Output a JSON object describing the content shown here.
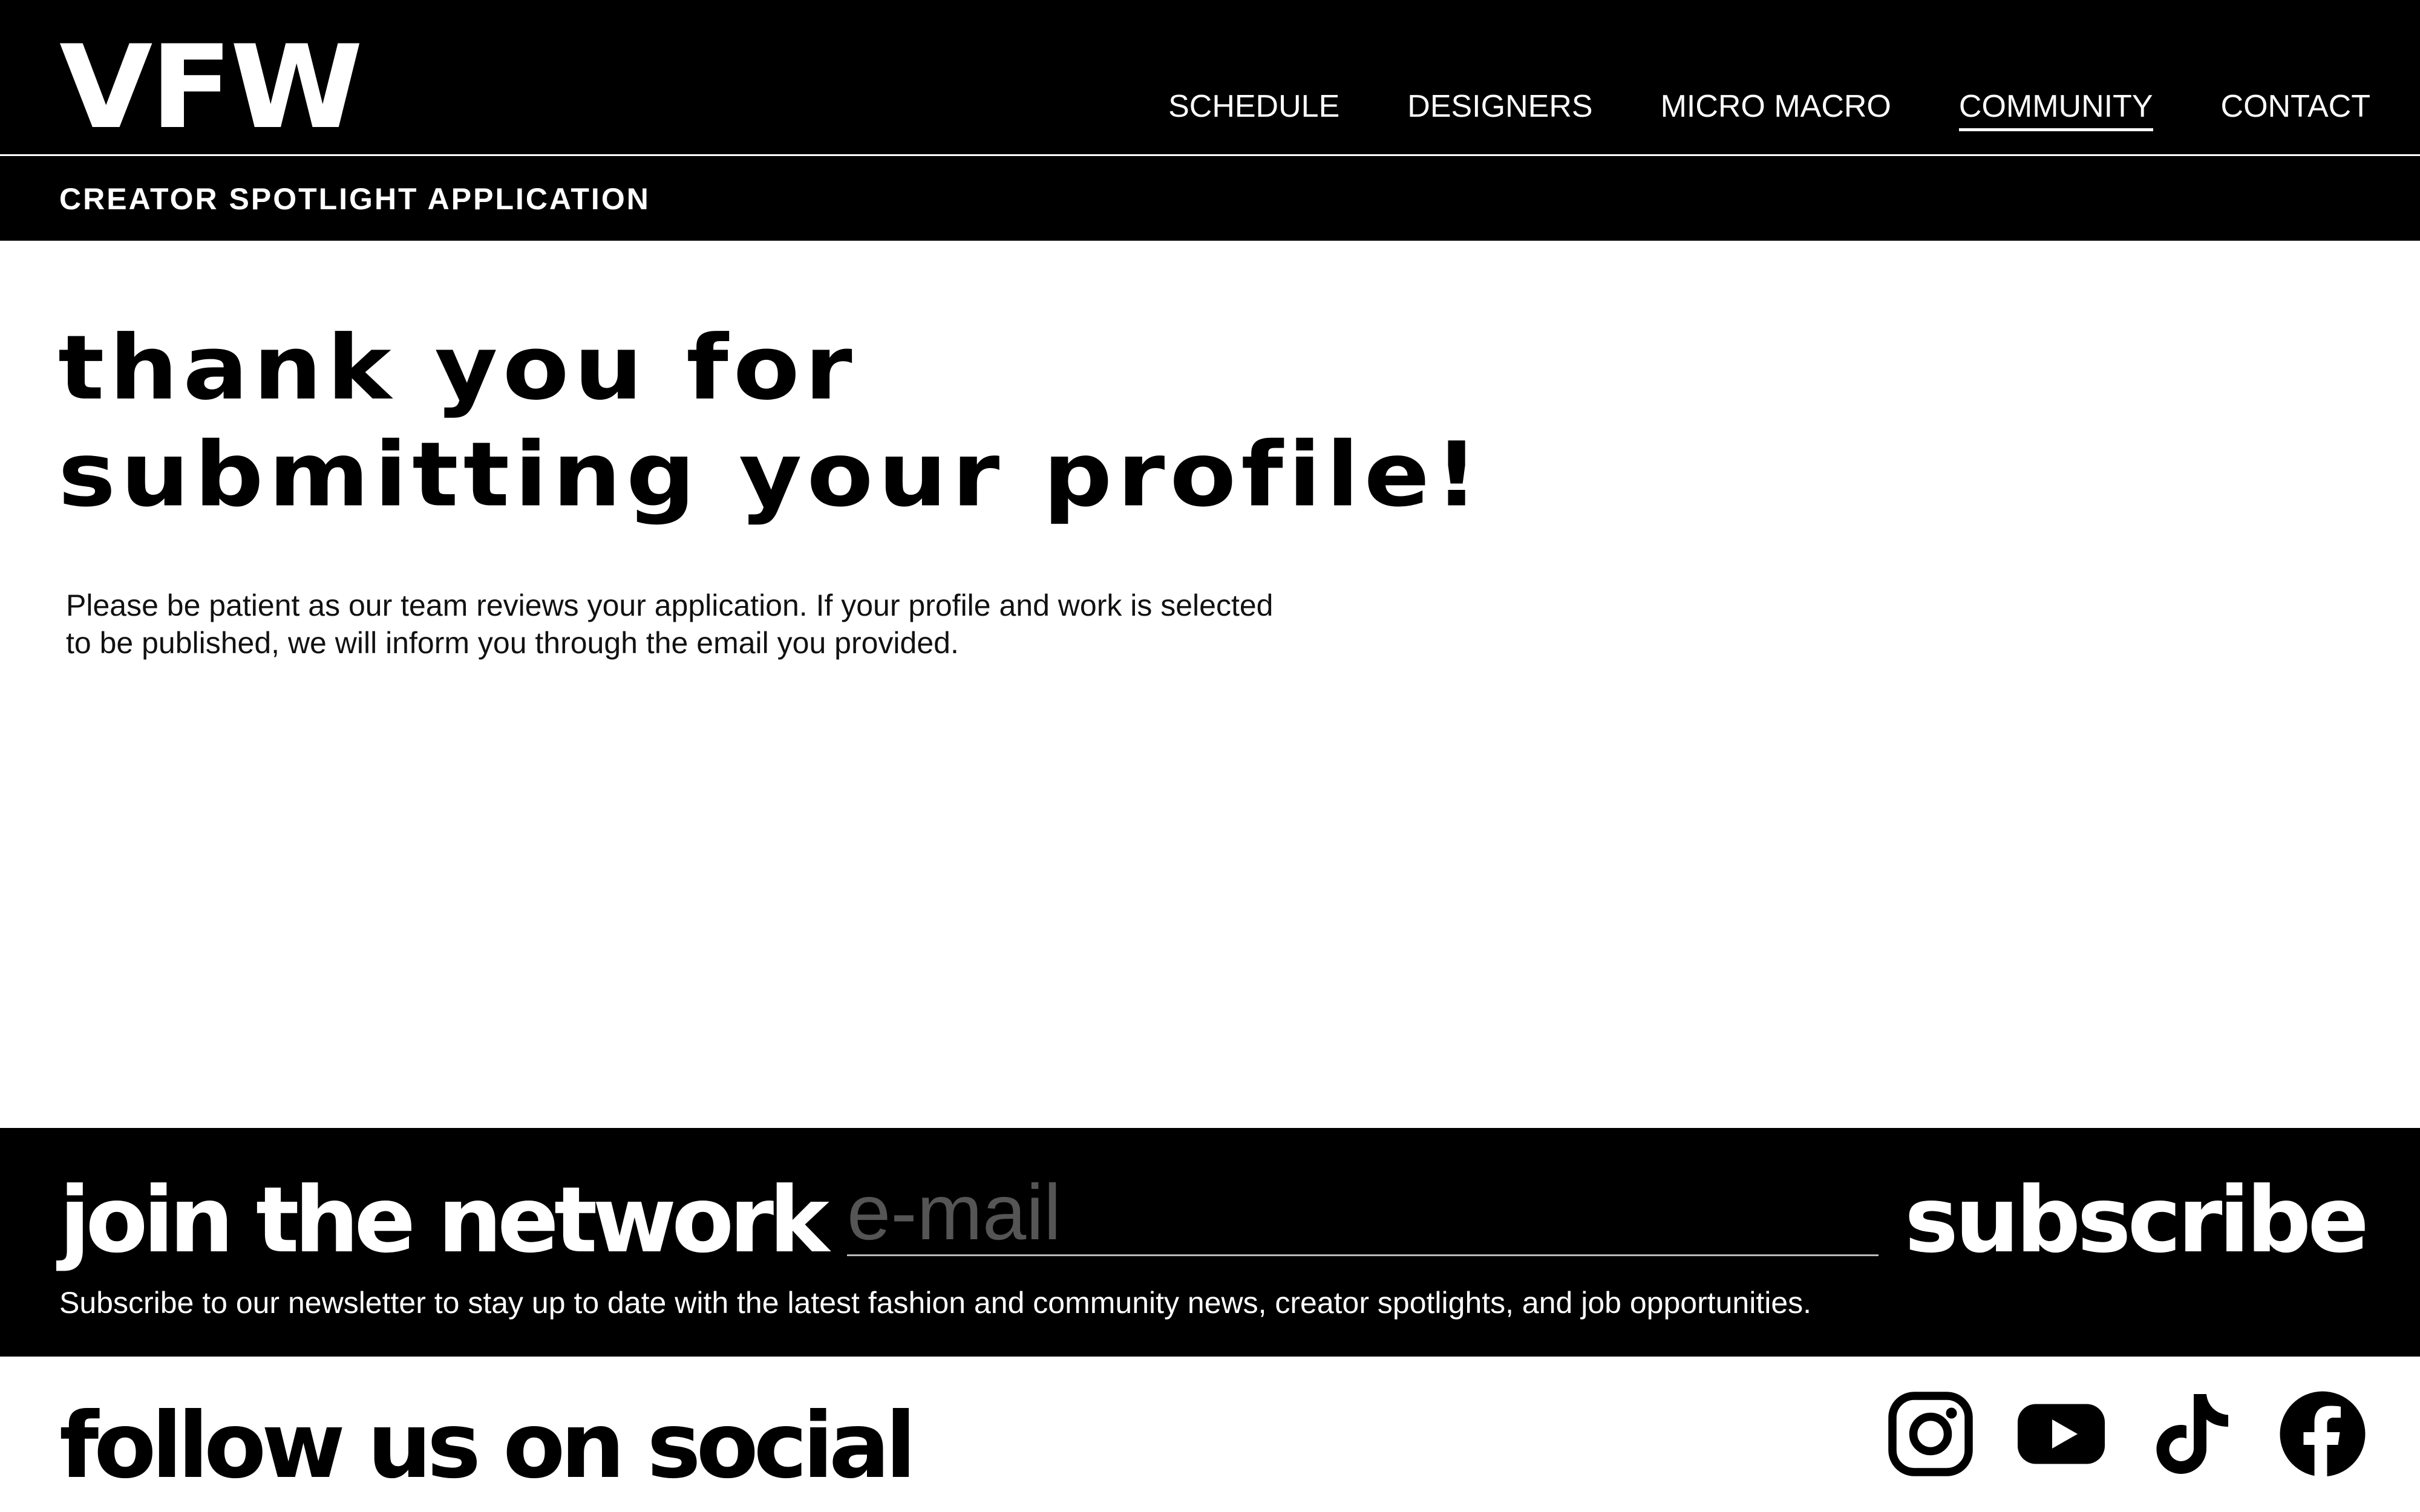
{
  "header": {
    "logo": "VFW",
    "nav": [
      {
        "label": "SCHEDULE"
      },
      {
        "label": "DESIGNERS"
      },
      {
        "label": "MICRO MACRO"
      },
      {
        "label": "COMMUNITY",
        "active": true
      },
      {
        "label": "CONTACT"
      }
    ],
    "subtitle": "CREATOR SPOTLIGHT APPLICATION"
  },
  "main": {
    "headline_line1": "thank you for",
    "headline_line2": "submitting your profile!",
    "message": "Please be patient as our team reviews your application. If your profile and work is selected to be published, we will inform you through the email you provided."
  },
  "newsletter": {
    "title": "join the network",
    "email_placeholder": "e-mail",
    "subscribe_label": "subscribe",
    "description": "Subscribe to our newsletter to stay up to date with the latest fashion and community news, creator spotlights, and job opportunities."
  },
  "social": {
    "title": "follow us on social",
    "icons": [
      "instagram-icon",
      "youtube-icon",
      "tiktok-icon",
      "facebook-icon"
    ]
  },
  "colors": {
    "primary": "#000000",
    "background": "#ffffff",
    "placeholder": "#555555"
  }
}
